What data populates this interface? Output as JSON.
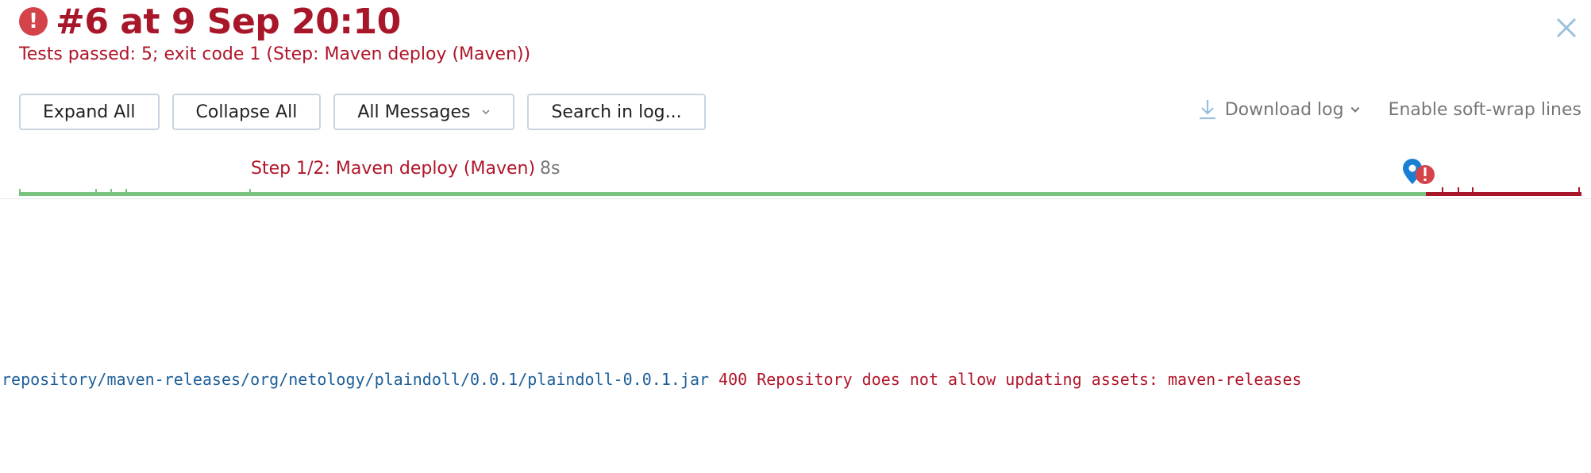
{
  "header": {
    "title": "#6 at 9 Sep 20:10",
    "subtitle": "Tests passed: 5; exit code 1 (Step: Maven deploy (Maven))",
    "status_icon": "error-circle-icon",
    "close_icon": "close-icon"
  },
  "toolbar": {
    "expand_all": "Expand All",
    "collapse_all": "Collapse All",
    "all_messages": "All Messages",
    "search_in_log": "Search in log..."
  },
  "right_tools": {
    "download_log": "Download log",
    "soft_wrap": "Enable soft-wrap lines"
  },
  "timeline": {
    "step_label": "Step 1/2: Maven deploy (Maven)",
    "step_duration": "8s",
    "colors": {
      "success": "#78c47f",
      "failure": "#a8162a",
      "marker_blue": "#1a7fd4",
      "marker_red": "#d5434a"
    }
  },
  "log": {
    "path": "repository/maven-releases/org/netology/plaindoll/0.0.1/plaindoll-0.0.1.jar",
    "message": "400 Repository does not allow updating assets: maven-releases"
  }
}
